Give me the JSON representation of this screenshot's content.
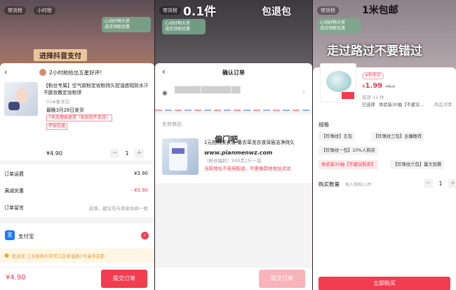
{
  "panel1": {
    "live_chips": [
      "带货榜",
      "小时榜"
    ],
    "promo": [
      "心动好物大赏",
      "进店领取优惠"
    ],
    "live_sign": "进择抖音支付",
    "banner": "2小时前给出五星好评!",
    "product": {
      "title": "【粉丝专属】空气款粉定妆粉持久控油遮瑕防水汗不脱妆散定妆粉饼",
      "variant": "01#象牙白",
      "ship": "最晚3月28日发货",
      "tags": [
        "7天无理由退货（拆封后不支持）",
        "坏损包退"
      ],
      "price": "¥4.90",
      "qty": "1"
    },
    "rows": [
      {
        "label": "订单运费",
        "value": "¥3.90"
      },
      {
        "label": "满减优惠",
        "value": "- ¥3.90"
      },
      {
        "label": "订单留言",
        "value": "选填，建议先与商家协商一致"
      }
    ],
    "pay_label": "支付宝",
    "address": "配送至 江苏省扬州市邗江区新盛路1号漫涛花都",
    "total": "¥4.90",
    "submit": "提交订单"
  },
  "panel2": {
    "sign1": "0.1件",
    "sign2": "包退包",
    "promo": [
      "心动好物大赏",
      "进店领取优惠"
    ],
    "chip": "带货榜",
    "title": "确认订单",
    "address_blur": "██████  ███████ ██",
    "section": "失效商品",
    "product_title": "1元抢购洗衣液 薰衣草洗衣液深层洁净持久",
    "variant": "（粉丝福利）500克1斤一袋",
    "warning": "当前地址不支持配送，可更换其他地址试试",
    "watermark1": "偏门吧",
    "watermark2": "www.pianmenwz.com",
    "submit": "提交订单"
  },
  "panel3": {
    "chip": "带货榜",
    "promo": [
      "心动好物大赏",
      "进店领取优惠"
    ],
    "sign1": "1米包邮",
    "sign2": "走过路过不要错过",
    "badge": "秒杀中",
    "price": "1.99",
    "orig_price": "¥8.9",
    "stock": "库存 11 件",
    "sold": "已选择",
    "spec_desc": "体验装30抽【不建议...",
    "detail_link": "商品详情",
    "spec_label": "规格",
    "specs": [
      "【珍珠纹】五包",
      "【珍珠纹三包】主播推荐",
      "【珍珠纹一包】10%人购买",
      "体验装30抽【不建议购买】",
      "【珍珠纹六包】量大划算"
    ],
    "qty_label": "购买数量",
    "qty_limit": "每人限购11件",
    "qty": "1",
    "buy": "立即购买"
  }
}
